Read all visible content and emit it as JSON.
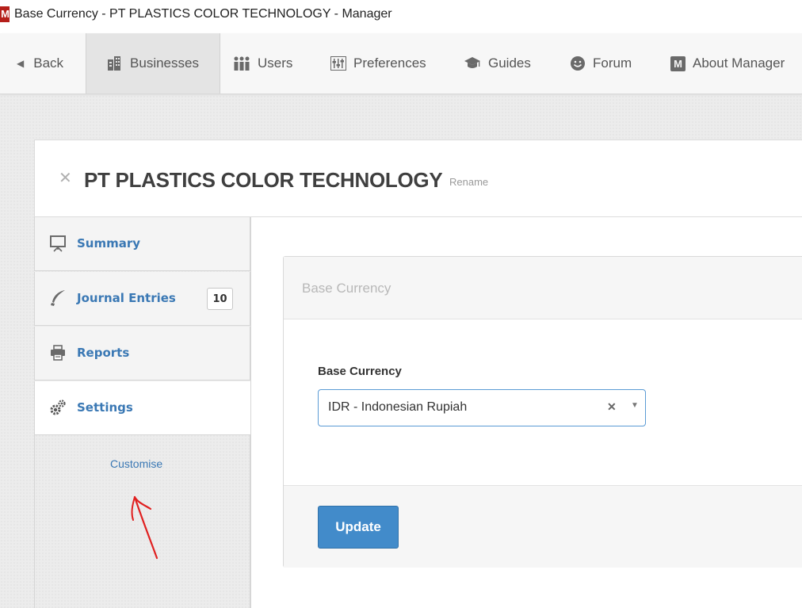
{
  "window": {
    "logo_text": "M",
    "title": "Base Currency - PT PLASTICS COLOR TECHNOLOGY - Manager"
  },
  "nav": {
    "back": "Back",
    "businesses": "Businesses",
    "users": "Users",
    "preferences": "Preferences",
    "guides": "Guides",
    "forum": "Forum",
    "about_logo": "M",
    "about": "About Manager"
  },
  "business": {
    "close_icon": "✕",
    "name": "PT PLASTICS COLOR TECHNOLOGY",
    "rename": "Rename"
  },
  "sidebar": {
    "items": [
      {
        "label": "Summary",
        "icon": "presentation-board-icon"
      },
      {
        "label": "Journal Entries",
        "icon": "quill-pen-icon",
        "badge": "10"
      },
      {
        "label": "Reports",
        "icon": "printer-icon"
      },
      {
        "label": "Settings",
        "icon": "gears-icon",
        "active": true
      }
    ],
    "customise": "Customise"
  },
  "form": {
    "panel_title": "Base Currency",
    "field_label": "Base Currency",
    "selected_value": "IDR - Indonesian Rupiah",
    "clear_icon": "✕",
    "caret_icon": "▼",
    "update_label": "Update"
  },
  "colors": {
    "link": "#3a78b4",
    "primary_button": "#428bca",
    "annotation_arrow": "#e02020"
  }
}
